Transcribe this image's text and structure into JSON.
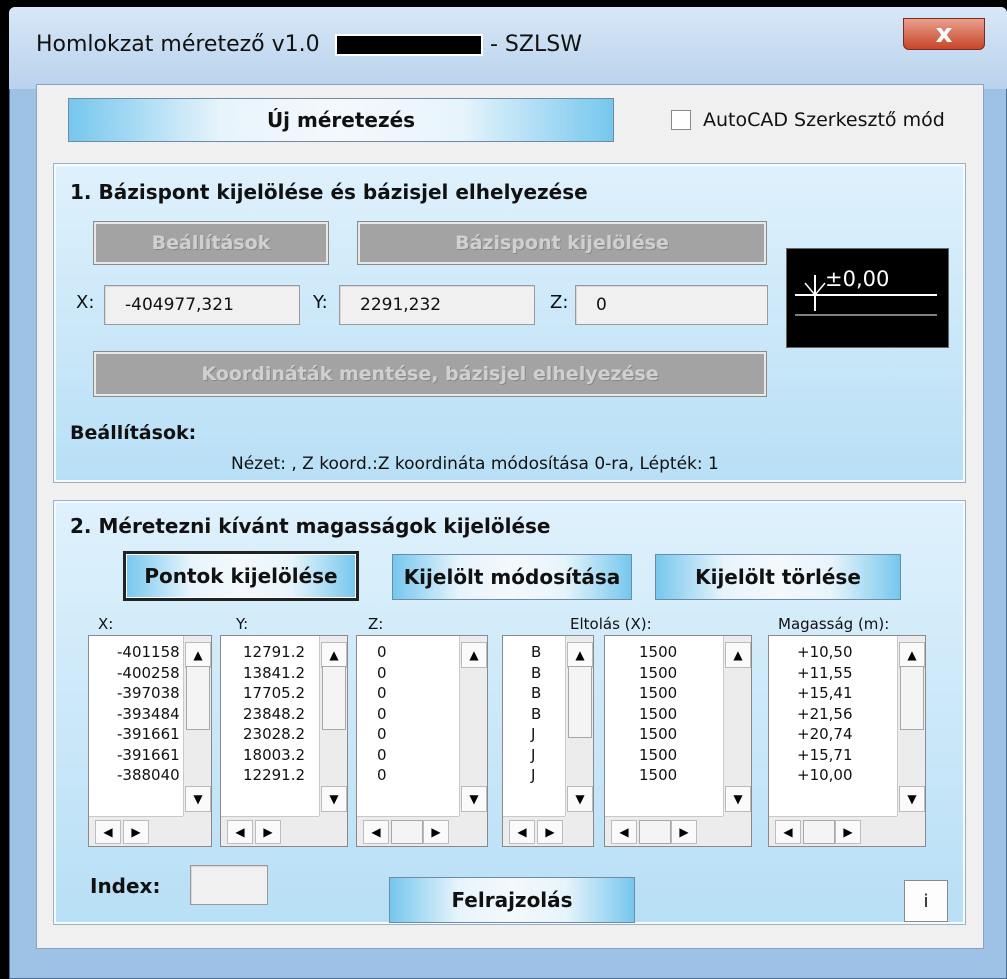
{
  "window": {
    "title": "Homlokzat méretező v1.0",
    "title_suffix": "- SZLSW",
    "close_glyph": "x"
  },
  "top": {
    "new_button": "Új méretezés",
    "autocad_checkbox_label": "AutoCAD Szerkesztő mód",
    "autocad_checked": false
  },
  "section1": {
    "title": "1. Bázispont kijelölése és bázisjel elhelyezése",
    "settings_button": "Beállítások",
    "basepoint_button": "Bázispont kijelölése",
    "x_label": "X:",
    "x_value": "-404977,321",
    "y_label": "Y:",
    "y_value": "2291,232",
    "z_label": "Z:",
    "z_value": "0",
    "preview_text": "±0,00",
    "save_button": "Koordináták mentése, bázisjel elhelyezése",
    "settings_heading": "Beállítások:",
    "settings_text": "Nézet: , Z koord.:Z koordináta módosítása 0-ra, Lépték: 1"
  },
  "section2": {
    "title": "2. Méretezni kívánt magasságok kijelölése",
    "select_button": "Pontok kijelölése",
    "modify_button": "Kijelölt módosítása",
    "delete_button": "Kijelölt törlése",
    "col_x": "X:",
    "col_y": "Y:",
    "col_z": "Z:",
    "col_offset": "Eltolás (X):",
    "col_height": "Magasság (m):",
    "x_values": [
      "-401158",
      "-400258",
      "-397038",
      "-393484",
      "-391661",
      "-391661",
      "-388040"
    ],
    "y_values": [
      "12791.2",
      "13841.2",
      "17705.2",
      "23848.2",
      "23028.2",
      "18003.2",
      "12291.2"
    ],
    "z_values": [
      "0",
      "0",
      "0",
      "0",
      "0",
      "0",
      "0"
    ],
    "side_values": [
      "B",
      "B",
      "B",
      "B",
      "J",
      "J",
      "J"
    ],
    "offset_values": [
      "1500",
      "1500",
      "1500",
      "1500",
      "1500",
      "1500",
      "1500"
    ],
    "height_values": [
      "+10,50",
      "+11,55",
      "+15,41",
      "+21,56",
      "+20,74",
      "+15,71",
      "+10,00"
    ],
    "index_label": "Index:",
    "index_value": "",
    "draw_button": "Felrajzolás",
    "info_button": "i"
  },
  "icons": {
    "scroll_up": "▲",
    "scroll_down": "▼",
    "scroll_left": "◀",
    "scroll_right": "▶"
  }
}
